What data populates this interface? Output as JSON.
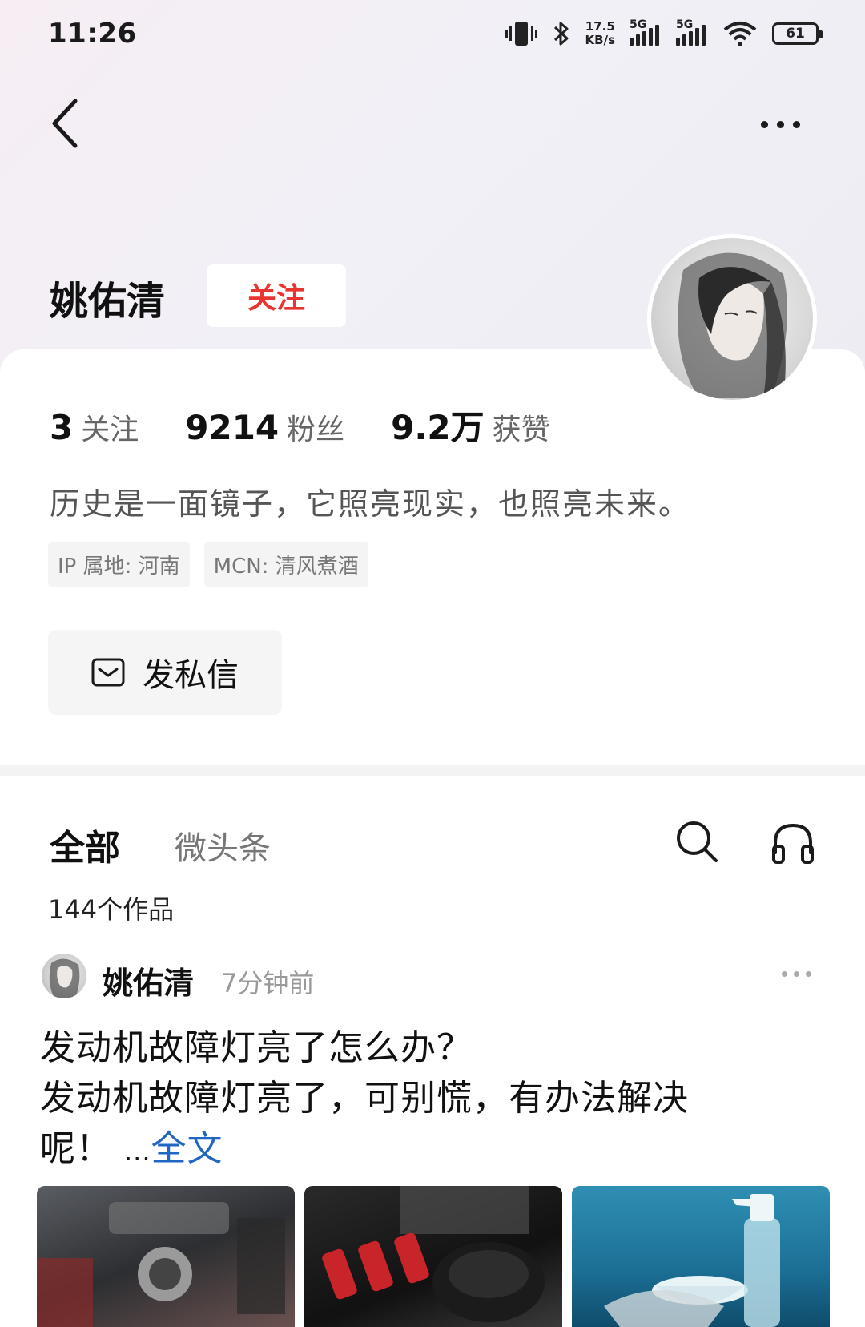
{
  "status_bar": {
    "time": "11:26",
    "speed_value": "17.5",
    "speed_unit": "KB/s",
    "sim1": "5G",
    "sim2": "5G",
    "battery": "61"
  },
  "profile": {
    "name": "姚佑清",
    "follow_label": "关注",
    "stats": [
      {
        "num": "3",
        "label": "关注"
      },
      {
        "num": "9214",
        "label": "粉丝"
      },
      {
        "num": "9.2万",
        "label": "获赞"
      }
    ],
    "bio": "历史是一面镜子，它照亮现实，也照亮未来。",
    "tags": [
      "IP 属地: 河南",
      "MCN: 清风煮酒"
    ],
    "dm_label": "发私信"
  },
  "tabs": {
    "all": "全部",
    "weitoutiao": "微头条"
  },
  "works_count": "144个作品",
  "post": {
    "author": "姚佑清",
    "time": "7分钟前",
    "line1": "发动机故障灯亮了怎么办？",
    "line2": "发动机故障灯亮了，可别慌，有办法解决",
    "line3": "呢！",
    "ellipsis": "...",
    "full_text_link": "全文"
  },
  "colors": {
    "follow_red": "#e8352f",
    "link_blue": "#2266c4"
  },
  "icons": [
    "back-icon",
    "more-icon",
    "mail-icon",
    "search-icon",
    "headphones-icon",
    "vibrate-icon",
    "bluetooth-icon",
    "wifi-icon",
    "battery-icon"
  ]
}
